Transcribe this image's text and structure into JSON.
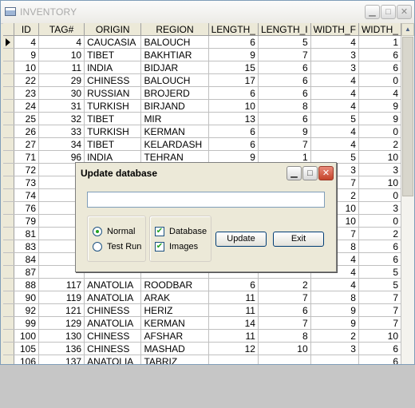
{
  "window": {
    "title": "INVENTORY"
  },
  "columns": [
    "ID",
    "TAG#",
    "ORIGIN",
    "REGION",
    "LENGTH_",
    "LENGTH_I",
    "WIDTH_F",
    "WIDTH_"
  ],
  "rows": [
    [
      "4",
      "4",
      "CAUCASIA",
      "BALOUCH",
      "6",
      "5",
      "4",
      "1"
    ],
    [
      "9",
      "10",
      "TIBET",
      "BAKHTIAR",
      "9",
      "7",
      "3",
      "6"
    ],
    [
      "10",
      "11",
      "INDIA",
      "BIDJAR",
      "15",
      "6",
      "3",
      "6"
    ],
    [
      "22",
      "29",
      "CHINESS",
      "BALOUCH",
      "17",
      "6",
      "4",
      "0"
    ],
    [
      "23",
      "30",
      "RUSSIAN",
      "BROJERD",
      "6",
      "6",
      "4",
      "4"
    ],
    [
      "24",
      "31",
      "TURKISH",
      "BIRJAND",
      "10",
      "8",
      "4",
      "9"
    ],
    [
      "25",
      "32",
      "TIBET",
      "MIR",
      "13",
      "6",
      "5",
      "9"
    ],
    [
      "26",
      "33",
      "TURKISH",
      "KERMAN",
      "6",
      "9",
      "4",
      "0"
    ],
    [
      "27",
      "34",
      "TIBET",
      "KELARDASH",
      "6",
      "7",
      "4",
      "2"
    ],
    [
      "71",
      "96",
      "INDIA",
      "TEHRAN",
      "9",
      "1",
      "5",
      "10"
    ],
    [
      "72",
      "",
      "",
      "",
      "",
      "",
      "3",
      "3"
    ],
    [
      "73",
      "",
      "",
      "",
      "",
      "",
      "7",
      "10"
    ],
    [
      "74",
      "",
      "",
      "",
      "",
      "",
      "2",
      "0"
    ],
    [
      "76",
      "",
      "",
      "",
      "",
      "",
      "10",
      "3"
    ],
    [
      "79",
      "",
      "",
      "",
      "",
      "",
      "10",
      "0"
    ],
    [
      "81",
      "",
      "",
      "",
      "",
      "",
      "7",
      "2"
    ],
    [
      "83",
      "",
      "",
      "",
      "",
      "",
      "8",
      "6"
    ],
    [
      "84",
      "",
      "",
      "",
      "",
      "",
      "4",
      "6"
    ],
    [
      "87",
      "",
      "",
      "",
      "",
      "",
      "4",
      "5"
    ],
    [
      "88",
      "117",
      "ANATOLIA",
      "ROODBAR",
      "6",
      "2",
      "4",
      "5"
    ],
    [
      "90",
      "119",
      "ANATOLIA",
      "ARAK",
      "11",
      "7",
      "8",
      "7"
    ],
    [
      "92",
      "121",
      "CHINESS",
      "HERIZ",
      "11",
      "6",
      "9",
      "7"
    ],
    [
      "99",
      "129",
      "ANATOLIA",
      "KERMAN",
      "14",
      "7",
      "9",
      "7"
    ],
    [
      "100",
      "130",
      "CHINESS",
      "AFSHAR",
      "11",
      "8",
      "2",
      "10"
    ],
    [
      "105",
      "136",
      "CHINESS",
      "MASHAD",
      "12",
      "10",
      "3",
      "6"
    ],
    [
      "106",
      "137",
      "ANATOLIA",
      "TABRIZ",
      "",
      "",
      "",
      "6"
    ]
  ],
  "dialog": {
    "title": "Update database",
    "input_value": "",
    "radios": [
      {
        "label": "Normal",
        "checked": true
      },
      {
        "label": "Test Run",
        "checked": false
      }
    ],
    "checks": [
      {
        "label": "Database",
        "checked": true
      },
      {
        "label": "Images",
        "checked": true
      }
    ],
    "update_label": "Update",
    "exit_label": "Exit"
  },
  "icons": {
    "minimize": "minimize-icon",
    "maximize": "maximize-icon",
    "close": "close-icon",
    "row-selector": "row-pointer-icon"
  }
}
